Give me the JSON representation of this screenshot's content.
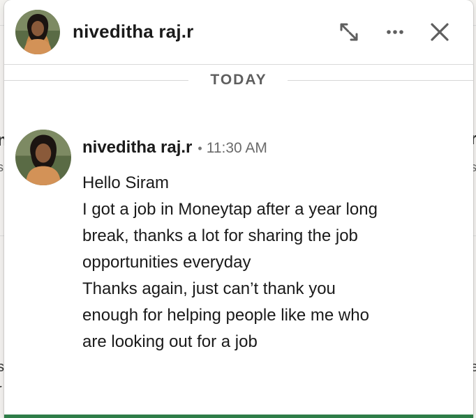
{
  "conversation": {
    "participant_name": "niveditha raj.r",
    "avatar_icon": "profile-photo",
    "actions": {
      "expand_icon": "expand-icon",
      "more_icon": "more-options-icon",
      "close_icon": "close-icon"
    }
  },
  "divider": {
    "label": "TODAY"
  },
  "messages": [
    {
      "sender": "niveditha raj.r",
      "separator": "•",
      "time": "11:30 AM",
      "lines": [
        "Hello Siram",
        "I got a job in Moneytap after a year long",
        "break, thanks a lot for sharing the job",
        "opportunities everyday",
        "Thanks again, just can’t thank you",
        "enough for helping people like me who",
        "are looking out for a job"
      ]
    }
  ],
  "colors": {
    "accent_bar": "#2e7d48",
    "avatar_bg": "#c98a4b",
    "text_primary": "#1a1a1a",
    "text_secondary": "#6b6b6b"
  }
}
